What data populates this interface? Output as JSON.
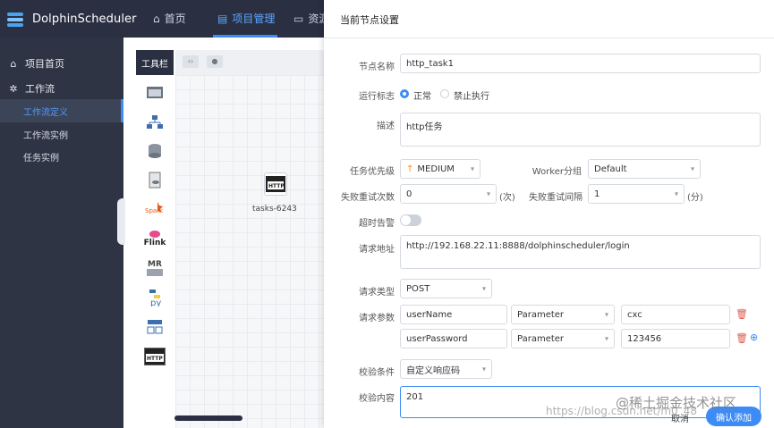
{
  "header": {
    "brand": "DolphinScheduler",
    "nav": [
      {
        "label": "首页",
        "icon": "home-icon"
      },
      {
        "label": "项目管理",
        "icon": "folder-icon",
        "active": true
      },
      {
        "label": "资源",
        "icon": "folder-open-icon"
      }
    ]
  },
  "sidebar": {
    "items": [
      {
        "label": "项目首页",
        "icon": "home-icon"
      },
      {
        "label": "工作流",
        "icon": "gear-icon"
      }
    ],
    "subitems": [
      {
        "label": "工作流定义",
        "active": true
      },
      {
        "label": "工作流实例"
      },
      {
        "label": "任务实例"
      }
    ]
  },
  "toolbar": {
    "title": "工具栏",
    "tools": [
      "shell-icon",
      "sub-process-icon",
      "procedure-icon",
      "sql-icon",
      "spark-icon",
      "flink-icon",
      "mr-icon",
      "python-icon",
      "dependent-icon",
      "http-icon"
    ],
    "flink_label": "Flink",
    "mr_label": "MR",
    "py_label": "py",
    "spark_label": "Spark"
  },
  "canvas": {
    "task_name": "tasks-6243",
    "task_icon_text": "HTTP"
  },
  "dialog": {
    "title": "当前节点设置",
    "node_name_label": "节点名称",
    "node_name_value": "http_task1",
    "run_flag_label": "运行标志",
    "run_flag_normal": "正常",
    "run_flag_forbid": "禁止执行",
    "desc_label": "描述",
    "desc_value": "http任务",
    "priority_label": "任务优先级",
    "priority_value": "MEDIUM",
    "worker_group_label": "Worker分组",
    "worker_group_value": "Default",
    "retry_times_label": "失败重试次数",
    "retry_times_value": "0",
    "retry_times_unit": "(次)",
    "retry_interval_label": "失败重试间隔",
    "retry_interval_value": "1",
    "retry_interval_unit": "(分)",
    "timeout_label": "超时告警",
    "url_label": "请求地址",
    "url_value": "http://192.168.22.11:8888/dolphinscheduler/login",
    "method_label": "请求类型",
    "method_value": "POST",
    "params_label": "请求参数",
    "params": [
      {
        "name": "userName",
        "type": "Parameter",
        "value": "cxc"
      },
      {
        "name": "userPassword",
        "type": "Parameter",
        "value": "123456"
      }
    ],
    "check_label": "校验条件",
    "check_value": "自定义响应码",
    "check_content_label": "校验内容",
    "check_content_value": "201",
    "cancel_label": "取消",
    "confirm_label": "确认添加"
  },
  "watermark": {
    "community": "@稀土掘金技术社区",
    "url": "https://blog.csdn.net/m0_48"
  },
  "colors": {
    "header_bg": "#2a3042",
    "sidebar_bg": "#2e3444",
    "accent": "#3d8cf6"
  }
}
